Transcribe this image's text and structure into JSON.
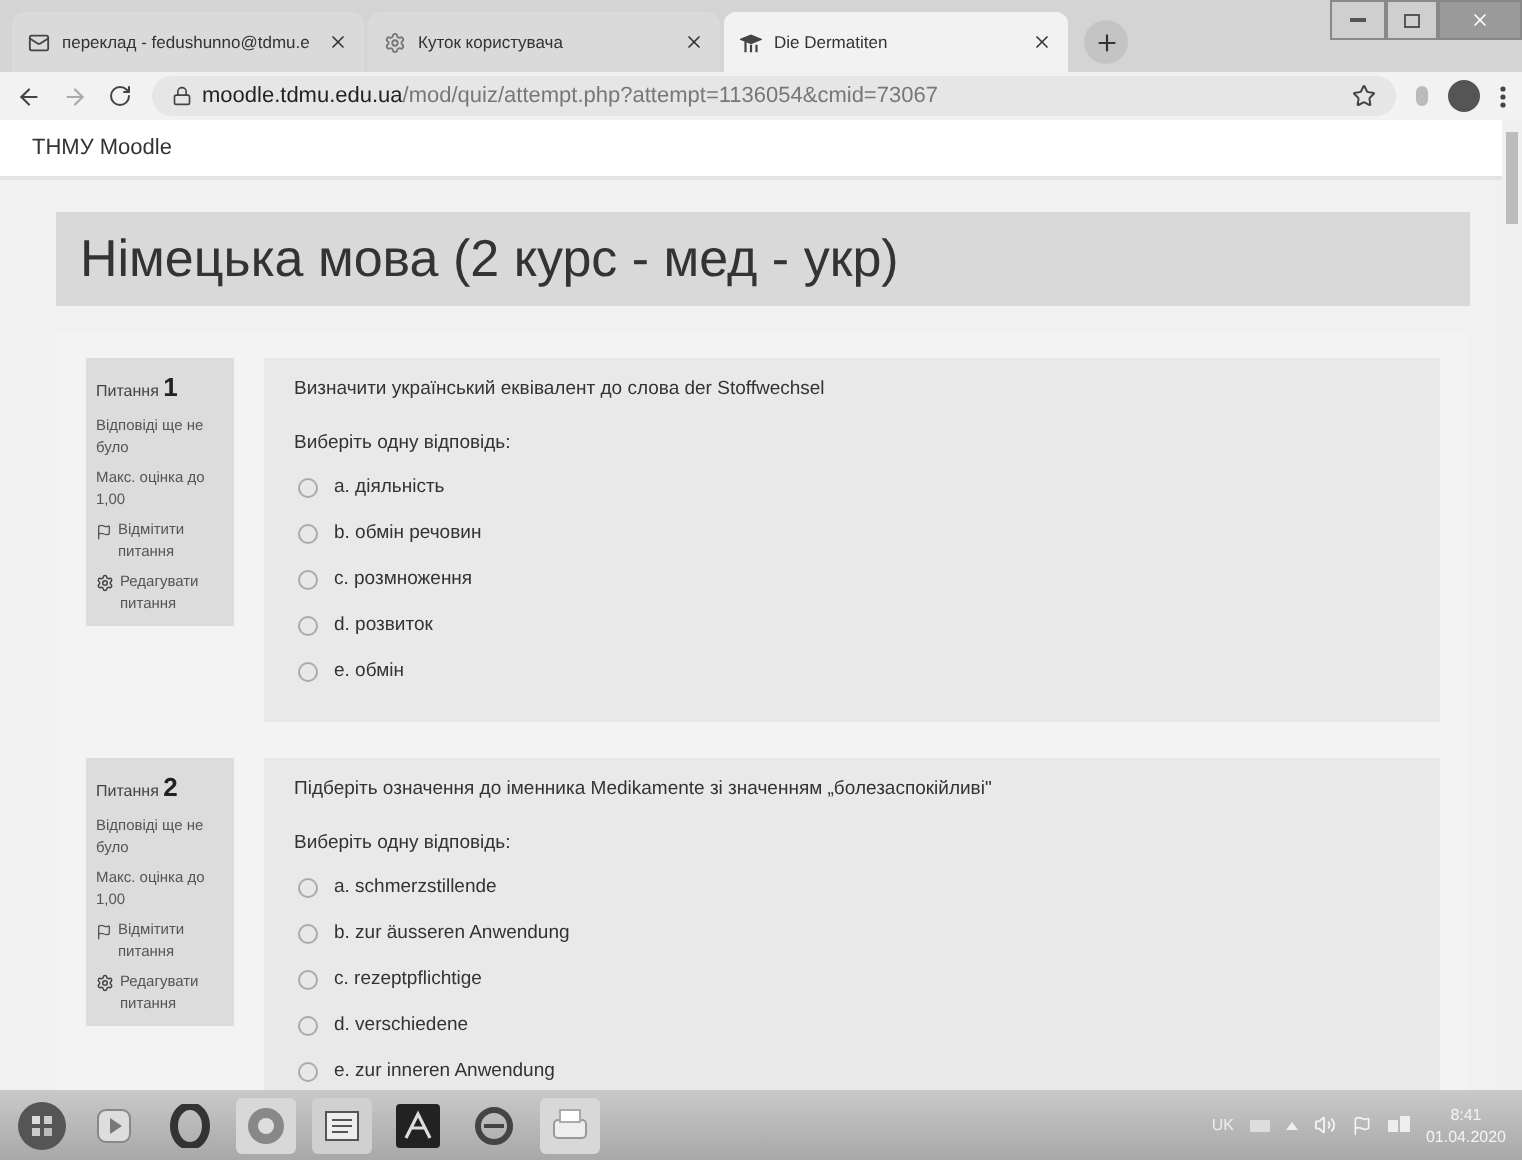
{
  "browser": {
    "tabs": [
      {
        "title": "переклад - fedushunno@tdmu.e",
        "selected": false
      },
      {
        "title": "Куток користувача",
        "selected": false
      },
      {
        "title": "Die Dermatiten",
        "selected": true
      }
    ],
    "url_host": "moodle.tdmu.edu.ua",
    "url_path": "/mod/quiz/attempt.php?attempt=1136054&cmid=73067"
  },
  "site_name": "ТНМУ Moodle",
  "page_title": "Німецька мова (2 курс - мед - укр)",
  "questions": [
    {
      "label": "Питання",
      "number": "1",
      "status": "Відповіді ще не було",
      "max_grade": "Макс. оцінка до 1,00",
      "flag": "Відмітити питання",
      "edit": "Редагувати питання",
      "text": "Визначити український еквівалент до слова der Stoffwechsel",
      "prompt": "Виберіть одну відповідь:",
      "options": [
        {
          "text": "a. діяльність",
          "selected": false
        },
        {
          "text": "b. обмін речовин",
          "selected": false
        },
        {
          "text": "c. розмноження",
          "selected": false
        },
        {
          "text": "d. розвиток",
          "selected": false
        },
        {
          "text": "e. обмін",
          "selected": false
        }
      ]
    },
    {
      "label": "Питання",
      "number": "2",
      "status": "Відповіді ще не було",
      "max_grade": "Макс. оцінка до 1,00",
      "flag": "Відмітити питання",
      "edit": "Редагувати питання",
      "text": "Підберіть означення до іменника Medikamente зі значенням „болезаспокійливі\"",
      "prompt": "Виберіть одну відповідь:",
      "options": [
        {
          "text": "a. schmerzstillende",
          "selected": false
        },
        {
          "text": "b. zur äusseren Anwendung",
          "selected": false
        },
        {
          "text": "c. rezeptpflichtige",
          "selected": false
        },
        {
          "text": "d. verschiedene",
          "selected": false
        },
        {
          "text": "e. zur inneren Anwendung",
          "selected": false
        }
      ]
    }
  ],
  "taskbar": {
    "language": "UK",
    "time": "8:41",
    "date": "01.04.2020"
  }
}
